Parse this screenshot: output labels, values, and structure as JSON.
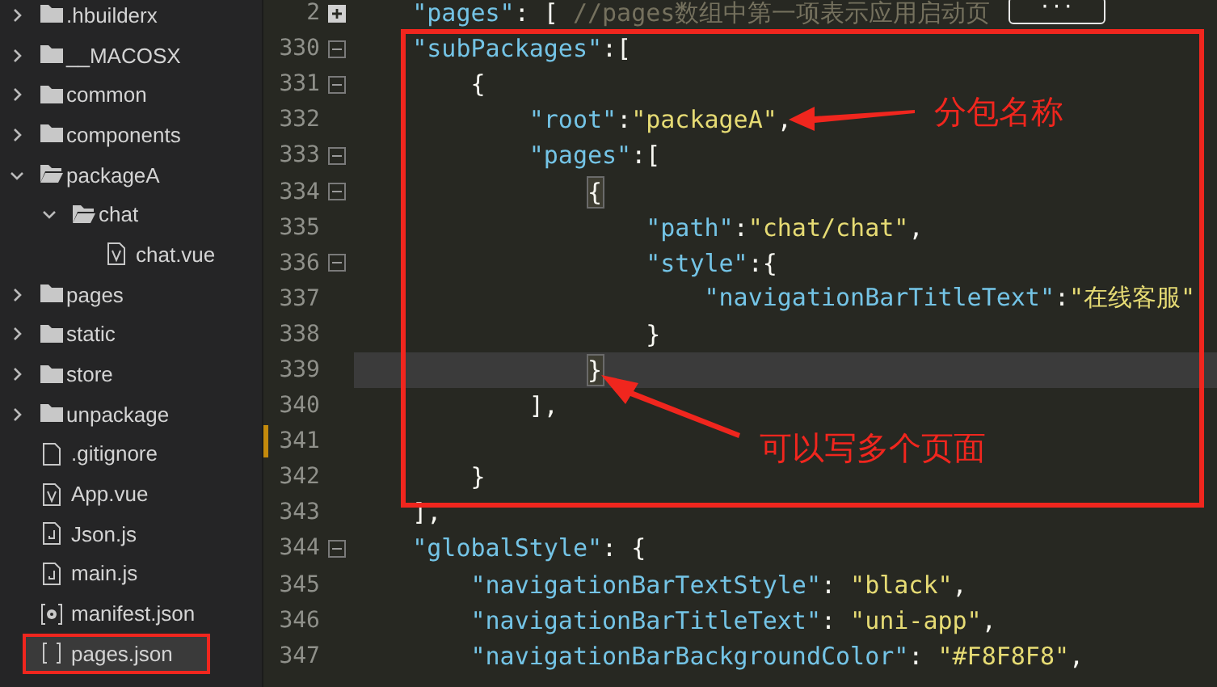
{
  "sidebar": {
    "items": [
      {
        "label": ".hbuilderx",
        "kind": "folder",
        "expanded": false,
        "selected": false
      },
      {
        "label": "__MACOSX",
        "kind": "folder",
        "expanded": false,
        "selected": false
      },
      {
        "label": "common",
        "kind": "folder",
        "expanded": false,
        "selected": false
      },
      {
        "label": "components",
        "kind": "folder",
        "expanded": false,
        "selected": false
      },
      {
        "label": "packageA",
        "kind": "folder",
        "expanded": true,
        "selected": false,
        "children": [
          {
            "label": "chat",
            "kind": "folder",
            "expanded": true,
            "selected": false,
            "children": [
              {
                "label": "chat.vue",
                "kind": "vue",
                "selected": false
              }
            ]
          }
        ]
      },
      {
        "label": "pages",
        "kind": "folder",
        "expanded": false,
        "selected": false
      },
      {
        "label": "static",
        "kind": "folder",
        "expanded": false,
        "selected": false
      },
      {
        "label": "store",
        "kind": "folder",
        "expanded": false,
        "selected": false
      },
      {
        "label": "unpackage",
        "kind": "folder",
        "expanded": false,
        "selected": false
      },
      {
        "label": ".gitignore",
        "kind": "file",
        "selected": false
      },
      {
        "label": "App.vue",
        "kind": "vue",
        "selected": false
      },
      {
        "label": "Json.js",
        "kind": "js",
        "selected": false
      },
      {
        "label": "main.js",
        "kind": "js",
        "selected": false
      },
      {
        "label": "manifest.json",
        "kind": "config",
        "selected": false
      },
      {
        "label": "pages.json",
        "kind": "json",
        "selected": true
      }
    ]
  },
  "editor": {
    "lines": [
      {
        "number": "2",
        "foldable": true,
        "folded": true,
        "current": false,
        "tokens": [
          {
            "kind": "key",
            "text": "    \"pages\""
          },
          {
            "kind": "punct",
            "text": ": [ "
          },
          {
            "kind": "comment",
            "text": "//pages数组中第一项表示应用启动页"
          }
        ],
        "badge": "···"
      },
      {
        "number": "330",
        "foldable": true,
        "folded": false,
        "current": false,
        "tokens": [
          {
            "kind": "key",
            "text": "    \"subPackages\""
          },
          {
            "kind": "punct",
            "text": ":["
          }
        ]
      },
      {
        "number": "331",
        "foldable": true,
        "folded": false,
        "current": false,
        "tokens": [
          {
            "kind": "punct",
            "text": "        {"
          }
        ]
      },
      {
        "number": "332",
        "foldable": false,
        "current": false,
        "tokens": [
          {
            "kind": "key",
            "text": "            \"root\""
          },
          {
            "kind": "punct",
            "text": ":"
          },
          {
            "kind": "str",
            "text": "\"packageA\""
          },
          {
            "kind": "punct",
            "text": ","
          }
        ]
      },
      {
        "number": "333",
        "foldable": true,
        "folded": false,
        "current": false,
        "tokens": [
          {
            "kind": "key",
            "text": "            \"pages\""
          },
          {
            "kind": "punct",
            "text": ":["
          }
        ]
      },
      {
        "number": "334",
        "foldable": true,
        "folded": false,
        "current": false,
        "tokens": [
          {
            "kind": "match",
            "text": "                {"
          }
        ]
      },
      {
        "number": "335",
        "foldable": false,
        "current": false,
        "tokens": [
          {
            "kind": "key",
            "text": "                    \"path\""
          },
          {
            "kind": "punct",
            "text": ":"
          },
          {
            "kind": "str",
            "text": "\"chat/chat\""
          },
          {
            "kind": "punct",
            "text": ","
          }
        ]
      },
      {
        "number": "336",
        "foldable": true,
        "folded": false,
        "current": false,
        "tokens": [
          {
            "kind": "key",
            "text": "                    \"style\""
          },
          {
            "kind": "punct",
            "text": ":{"
          }
        ]
      },
      {
        "number": "337",
        "foldable": false,
        "current": false,
        "tokens": [
          {
            "kind": "key",
            "text": "                        \"navigationBarTitleText\""
          },
          {
            "kind": "punct",
            "text": ":"
          },
          {
            "kind": "str",
            "text": "\"在线客服\""
          }
        ]
      },
      {
        "number": "338",
        "foldable": false,
        "current": false,
        "tokens": [
          {
            "kind": "punct",
            "text": "                    }"
          }
        ]
      },
      {
        "number": "339",
        "foldable": false,
        "current": true,
        "tokens": [
          {
            "kind": "match",
            "text": "                }"
          }
        ]
      },
      {
        "number": "340",
        "foldable": false,
        "current": false,
        "tokens": [
          {
            "kind": "punct",
            "text": "            ],"
          }
        ]
      },
      {
        "number": "341",
        "foldable": false,
        "current": false
      },
      {
        "number": "342",
        "foldable": false,
        "current": false,
        "tokens": [
          {
            "kind": "punct",
            "text": "        }"
          }
        ]
      },
      {
        "number": "343",
        "foldable": false,
        "current": false,
        "tokens": [
          {
            "kind": "punct",
            "text": "    ],"
          }
        ]
      },
      {
        "number": "344",
        "foldable": true,
        "folded": false,
        "current": false,
        "tokens": [
          {
            "kind": "key",
            "text": "    \"globalStyle\""
          },
          {
            "kind": "punct",
            "text": ": {"
          }
        ]
      },
      {
        "number": "345",
        "foldable": false,
        "current": false,
        "tokens": [
          {
            "kind": "key",
            "text": "        \"navigationBarTextStyle\""
          },
          {
            "kind": "punct",
            "text": ": "
          },
          {
            "kind": "str",
            "text": "\"black\""
          },
          {
            "kind": "punct",
            "text": ","
          }
        ]
      },
      {
        "number": "346",
        "foldable": false,
        "current": false,
        "tokens": [
          {
            "kind": "key",
            "text": "        \"navigationBarTitleText\""
          },
          {
            "kind": "punct",
            "text": ": "
          },
          {
            "kind": "str",
            "text": "\"uni-app\""
          },
          {
            "kind": "punct",
            "text": ","
          }
        ]
      },
      {
        "number": "347",
        "foldable": false,
        "current": false,
        "tokens": [
          {
            "kind": "key",
            "text": "        \"navigationBarBackgroundColor\""
          },
          {
            "kind": "punct",
            "text": ": "
          },
          {
            "kind": "str",
            "text": "\"#F8F8F8\""
          },
          {
            "kind": "punct",
            "text": ","
          }
        ]
      }
    ]
  },
  "annotations": [
    {
      "label": "分包名称"
    },
    {
      "label": "可以写多个页面"
    }
  ]
}
